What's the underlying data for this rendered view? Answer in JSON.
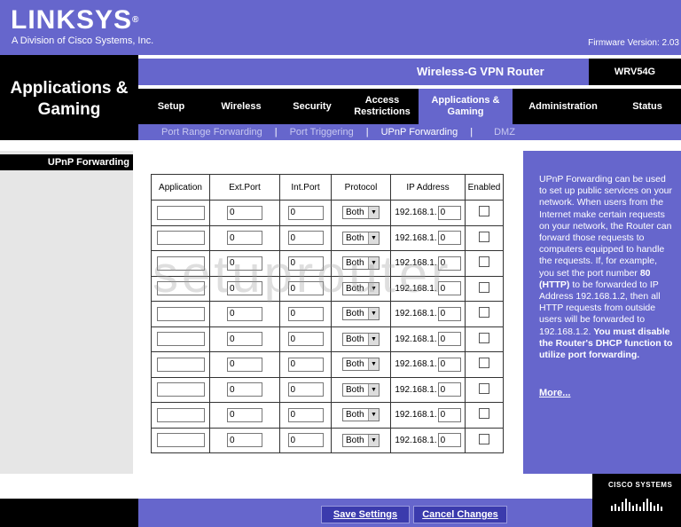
{
  "header": {
    "logo": "LINKSYS",
    "logo_mark": "®",
    "logo_sub": "A Division of Cisco Systems, Inc.",
    "firmware": "Firmware Version: 2.03",
    "section_title": "Applications & Gaming",
    "product_name": "Wireless-G VPN Router",
    "model": "WRV54G"
  },
  "nav": {
    "tabs": [
      {
        "label": "Setup"
      },
      {
        "label": "Wireless"
      },
      {
        "label": "Security"
      },
      {
        "label": "Access Restrictions"
      },
      {
        "label": "Applications & Gaming"
      },
      {
        "label": "Administration"
      },
      {
        "label": "Status"
      }
    ],
    "subtabs": [
      {
        "label": "Port Range Forwarding"
      },
      {
        "label": "Port Triggering"
      },
      {
        "label": "UPnP Forwarding"
      },
      {
        "label": "DMZ"
      }
    ]
  },
  "sidebar": {
    "label": "UPnP Forwarding"
  },
  "table": {
    "headers": [
      "Application",
      "Ext.Port",
      "Int.Port",
      "Protocol",
      "IP Address",
      "Enabled"
    ],
    "ip_prefix": "192.168.1.",
    "rows": [
      {
        "app": "",
        "ext": "0",
        "int": "0",
        "proto": "Both",
        "ip": "0"
      },
      {
        "app": "",
        "ext": "0",
        "int": "0",
        "proto": "Both",
        "ip": "0"
      },
      {
        "app": "",
        "ext": "0",
        "int": "0",
        "proto": "Both",
        "ip": "0"
      },
      {
        "app": "",
        "ext": "0",
        "int": "0",
        "proto": "Both",
        "ip": "0"
      },
      {
        "app": "",
        "ext": "0",
        "int": "0",
        "proto": "Both",
        "ip": "0"
      },
      {
        "app": "",
        "ext": "0",
        "int": "0",
        "proto": "Both",
        "ip": "0"
      },
      {
        "app": "",
        "ext": "0",
        "int": "0",
        "proto": "Both",
        "ip": "0"
      },
      {
        "app": "",
        "ext": "0",
        "int": "0",
        "proto": "Both",
        "ip": "0"
      },
      {
        "app": "",
        "ext": "0",
        "int": "0",
        "proto": "Both",
        "ip": "0"
      },
      {
        "app": "",
        "ext": "0",
        "int": "0",
        "proto": "Both",
        "ip": "0"
      }
    ]
  },
  "help": {
    "text1": "UPnP Forwarding can be used to set up public services on your network. When users from the Internet make certain requests on your network, the Router can forward those requests to computers equipped to handle the requests. If, for example, you set the port number ",
    "bold1": "80 (HTTP)",
    "text2": " to be forwarded to IP Address 192.168.1.2, then all HTTP requests from outside users will be forwarded to 192.168.1.2. ",
    "bold2": "You must disable the Router's DHCP function to utilize port forwarding.",
    "more": "More..."
  },
  "buttons": {
    "save": "Save Settings",
    "cancel": "Cancel Changes"
  },
  "footer": {
    "cisco": "CISCO SYSTEMS"
  },
  "watermark": "setuprouter",
  "colors": {
    "brand": "#6666cc",
    "dark": "#000000",
    "button": "#3b3bad"
  }
}
